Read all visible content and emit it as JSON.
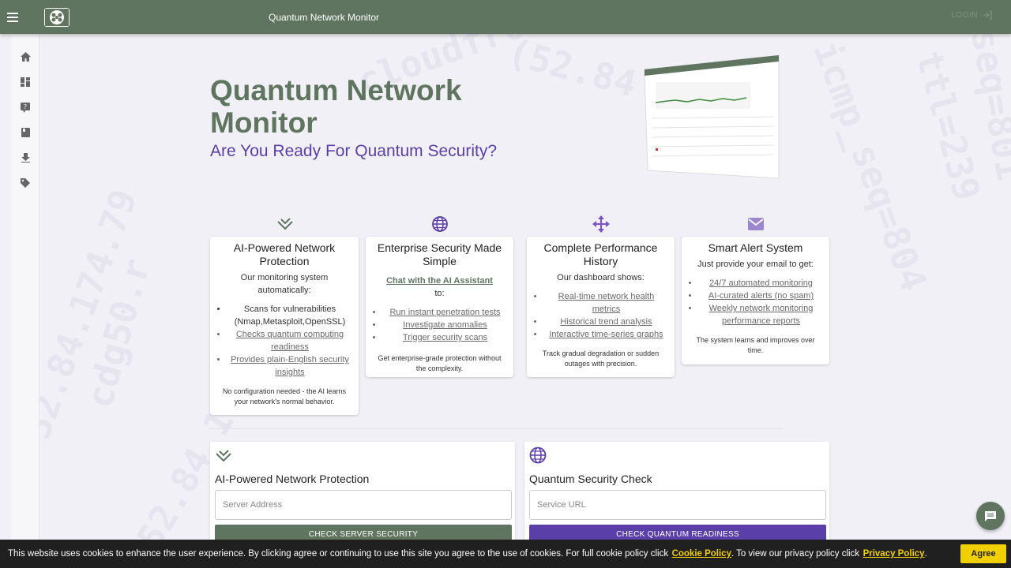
{
  "topbar": {
    "title": "Quantum Network Monitor",
    "login_label": "LOGIN"
  },
  "hero": {
    "title": "Quantum Network Monitor",
    "subtitle": "Are You Ready For Quantum Security?"
  },
  "cards": [
    {
      "title": "AI-Powered Network Protection",
      "intro": "Our monitoring system automatically:",
      "items": [
        "Scans for vulnerabilities (Nmap,Metasploit,OpenSSL)",
        "Checks quantum computing readiness",
        "Provides plain-English security insights"
      ],
      "footer": "No configuration needed - the AI learns your network's normal behavior."
    },
    {
      "title": "Enterprise Security Made Simple",
      "chat_link": "Chat with the AI Assistant",
      "chat_suffix": "to:",
      "items": [
        "Run instant penetration tests",
        "Investigate anomalies",
        "Trigger security scans"
      ],
      "footer": "Get enterprise-grade protection without the complexity."
    },
    {
      "title": "Complete Performance History",
      "intro": "Our dashboard shows:",
      "items": [
        "Real-time network health metrics",
        "Historical trend analysis",
        "Interactive time-series graphs"
      ],
      "footer": "Track gradual degradation or sudden outages with precision."
    },
    {
      "title": "Smart Alert System",
      "intro": "Just provide your email to get:",
      "items": [
        "24/7 automated monitoring",
        "AI-curated alerts (no spam)",
        "Weekly network monitoring performance reports"
      ],
      "footer": "The system learns and improves over time."
    }
  ],
  "panels": [
    {
      "title": "AI-Powered Network Protection",
      "placeholder": "Server Address",
      "button": "CHECK SERVER SECURITY",
      "color": "#5f7560"
    },
    {
      "title": "Quantum Security Check",
      "placeholder": "Service URL",
      "button": "CHECK QUANTUM READINESS",
      "color": "#5b3fa8"
    }
  ],
  "cookie": {
    "text1": "This website uses cookies to enhance the user experience. By clicking agree or continuing to use this site you agree to the use of cookies. For full cookie policy click",
    "cookie_link": "Cookie Policy",
    "text2": ". To view our privacy policy click",
    "privacy_link": "Privacy Policy",
    "text3": ".",
    "agree": "Agree"
  },
  "colors": {
    "brand_green": "#5f7560",
    "brand_purple": "#5b3fa8",
    "cookie_yellow": "#f0d000"
  },
  "icons": [
    "menu-icon",
    "home-icon",
    "dashboard-icon",
    "help-icon",
    "book-icon",
    "download-icon",
    "tag-icon",
    "chat-icon"
  ]
}
